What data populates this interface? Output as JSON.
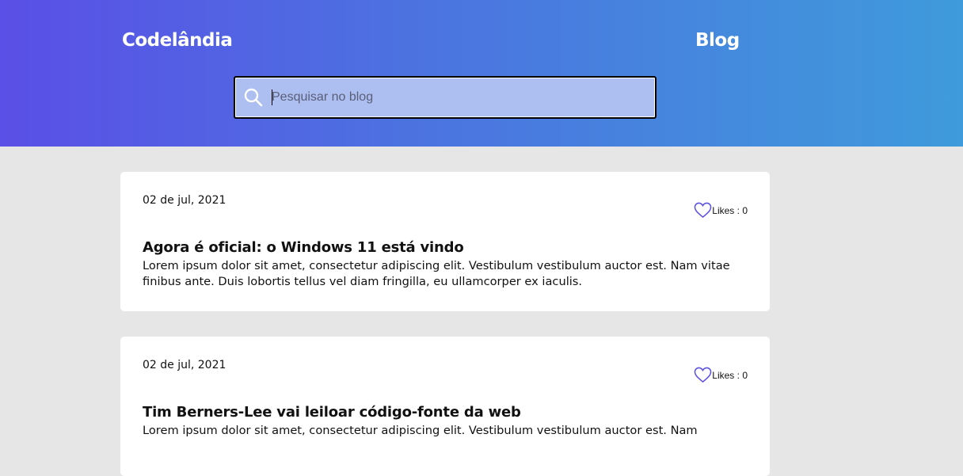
{
  "header": {
    "brand": "Codelândia",
    "nav_blog": "Blog"
  },
  "search": {
    "placeholder": "Pesquisar no blog",
    "value": ""
  },
  "posts": [
    {
      "date": "02 de jul, 2021",
      "likes_label": "Likes : 0",
      "title": "Agora é oficial: o Windows 11 está vindo",
      "body": "Lorem ipsum dolor sit amet, consectetur adipiscing elit. Vestibulum vestibulum auctor est. Nam vitae finibus ante. Duis lobortis tellus vel diam fringilla, eu ullamcorper ex iaculis."
    },
    {
      "date": "02 de jul, 2021",
      "likes_label": "Likes : 0",
      "title": "Tim Berners-Lee vai leiloar código-fonte da web",
      "body": "Lorem ipsum dolor sit amet, consectetur adipiscing elit. Vestibulum vestibulum auctor est. Nam"
    }
  ],
  "colors": {
    "gradient_start": "#5a4fe6",
    "gradient_end": "#3f9bdb",
    "heart": "#5a4fe6",
    "page_bg": "#e6e6e6"
  },
  "icons": {
    "search": "search-icon",
    "like": "heart-icon"
  }
}
